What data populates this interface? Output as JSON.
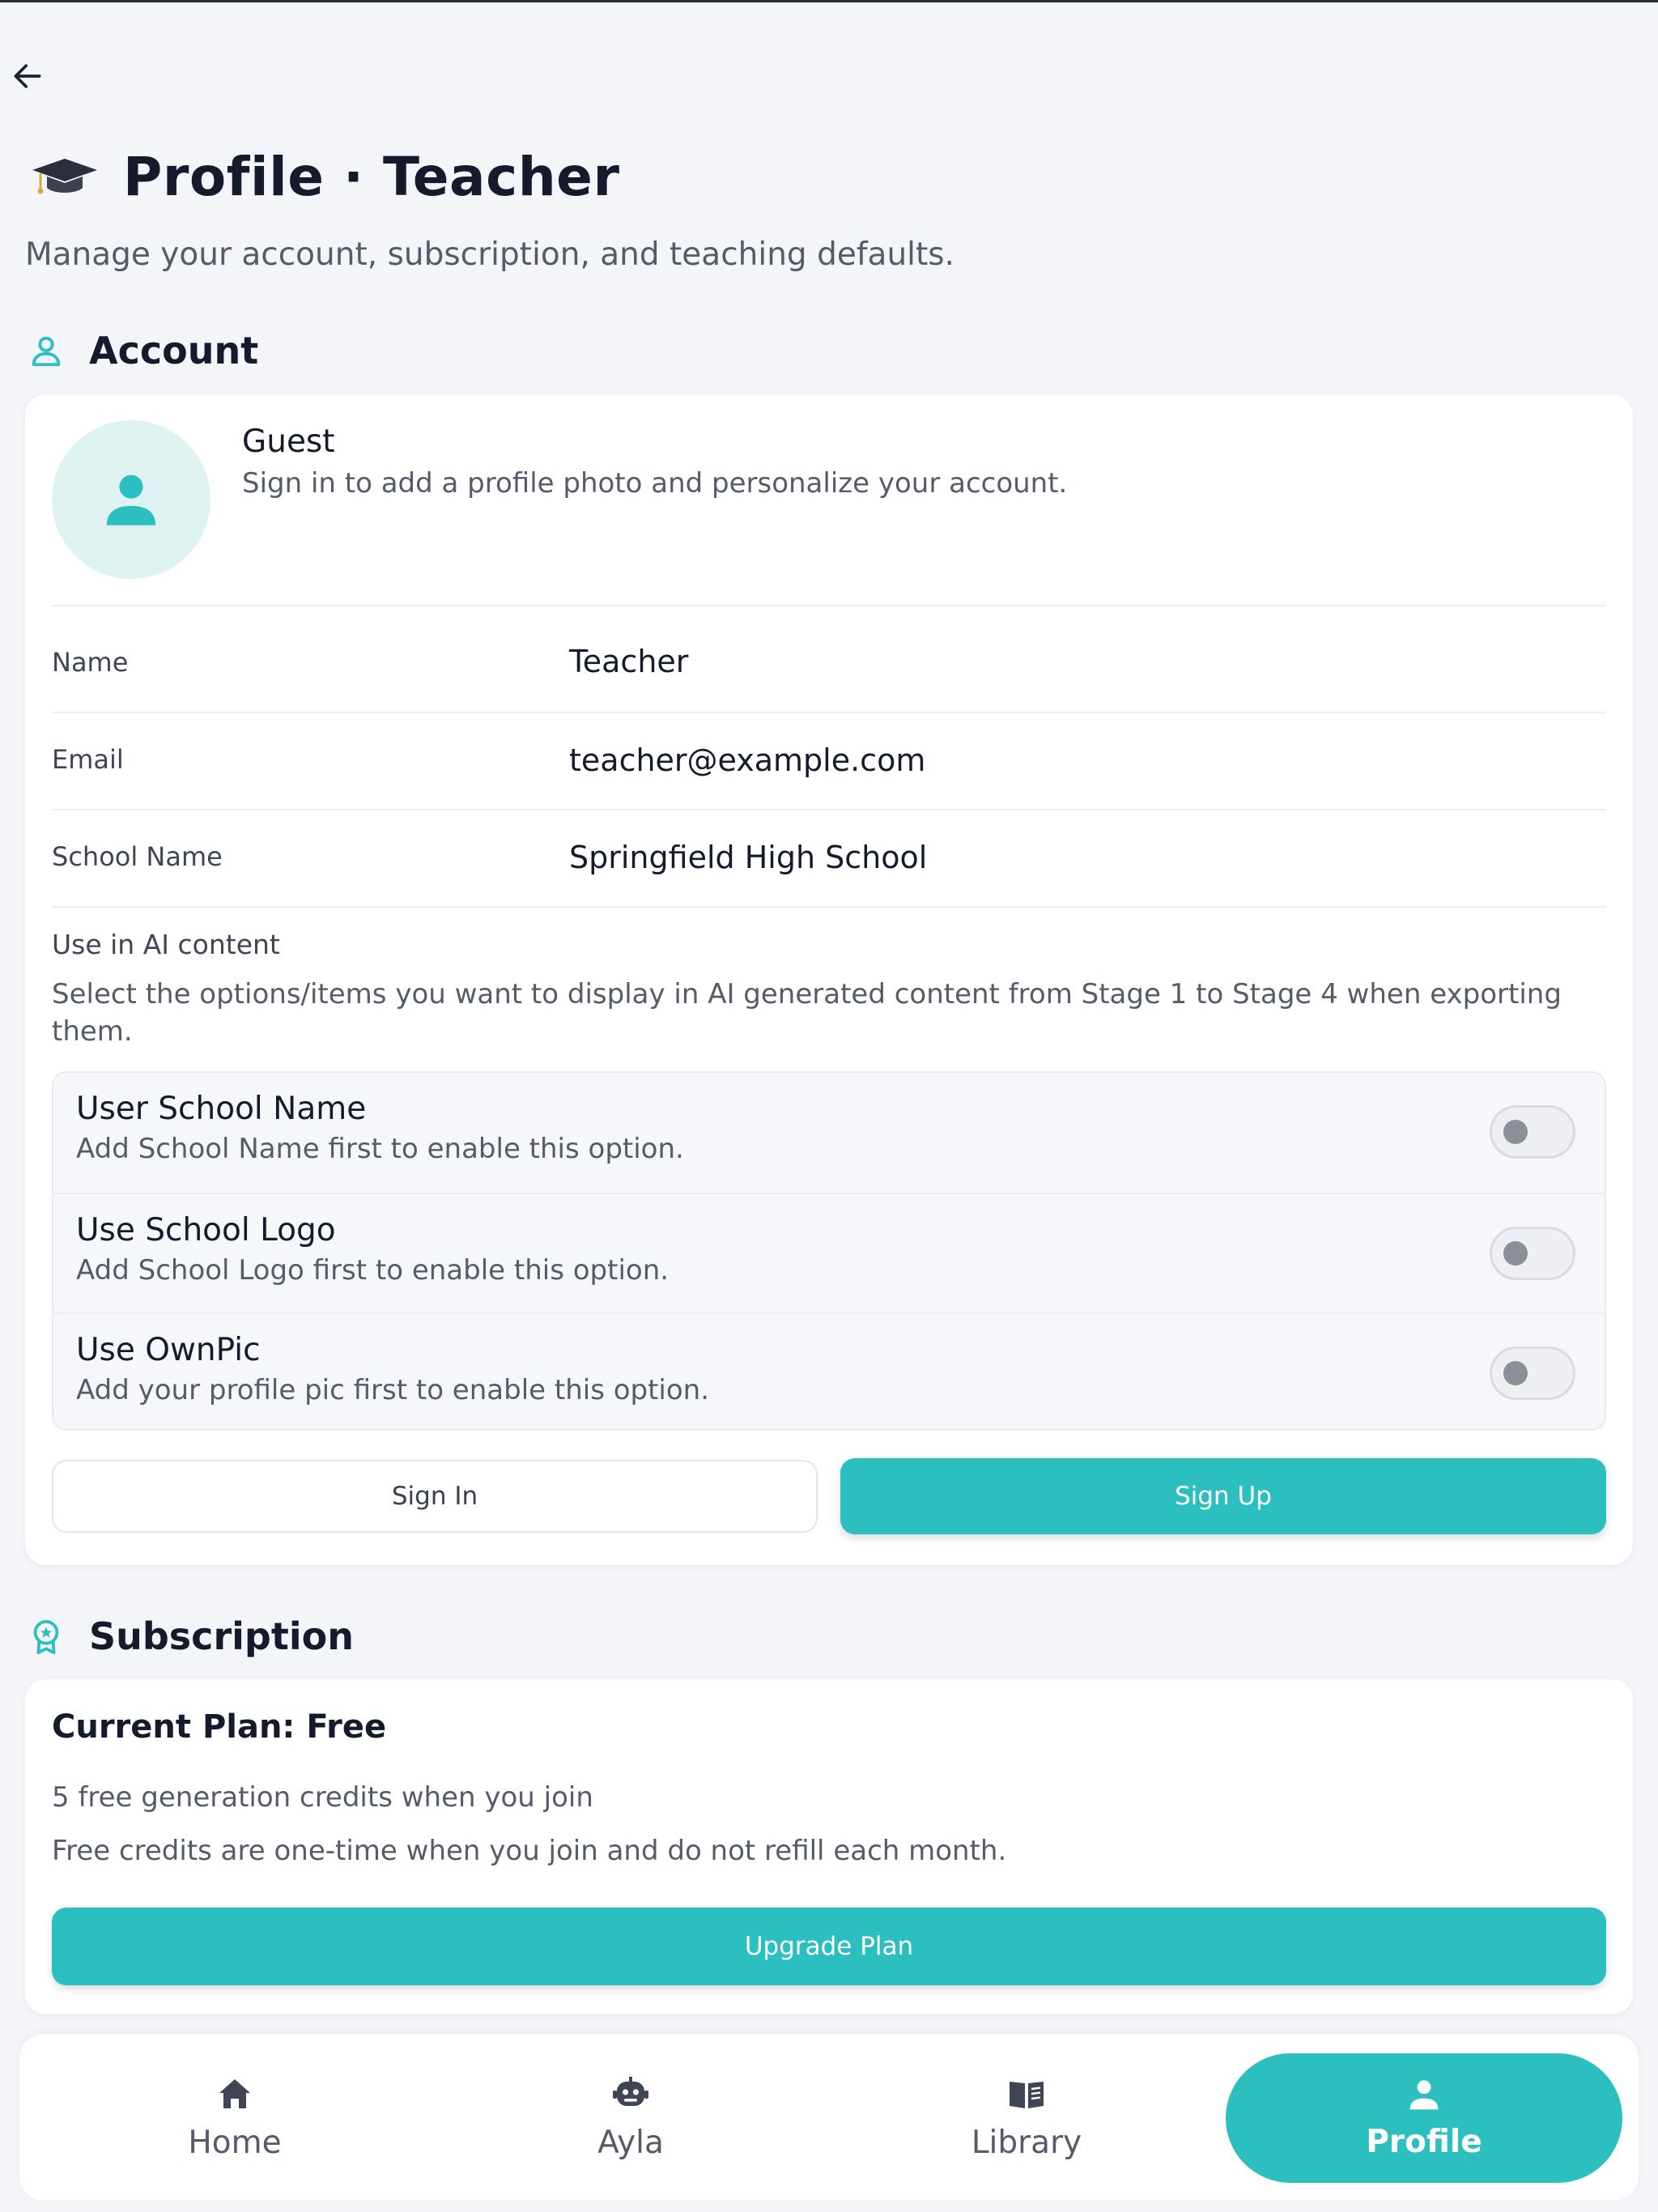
{
  "header": {
    "title": "Profile · Teacher",
    "subtitle": "Manage your account, subscription, and teaching defaults."
  },
  "account": {
    "section_title": "Account",
    "guest_name": "Guest",
    "guest_hint": "Sign in to add a profile photo and personalize your account.",
    "fields": [
      {
        "label": "Name",
        "value": "Teacher"
      },
      {
        "label": "Email",
        "value": "teacher@example.com"
      },
      {
        "label": "School Name",
        "value": "Springfield High School"
      }
    ],
    "ai_title": "Use in AI content",
    "ai_desc": "Select the options/items you want to display in AI generated content from Stage 1 to Stage 4 when exporting them.",
    "options": [
      {
        "title": "User School Name",
        "desc": "Add School Name first to enable this option.",
        "enabled": false
      },
      {
        "title": "Use School Logo",
        "desc": "Add School Logo first to enable this option.",
        "enabled": false
      },
      {
        "title": "Use OwnPic",
        "desc": "Add your profile pic first to enable this option.",
        "enabled": false
      }
    ],
    "sign_in_label": "Sign In",
    "sign_up_label": "Sign Up"
  },
  "subscription": {
    "section_title": "Subscription",
    "plan_title": "Current Plan: Free",
    "line1": "5 free generation credits when you join",
    "line2": "Free credits are one-time when you join and do not refill each month.",
    "upgrade_label": "Upgrade Plan"
  },
  "nav": {
    "items": [
      {
        "label": "Home",
        "icon": "home-icon"
      },
      {
        "label": "Ayla",
        "icon": "robot-icon"
      },
      {
        "label": "Library",
        "icon": "book-icon"
      },
      {
        "label": "Profile",
        "icon": "user-icon",
        "active": true
      }
    ]
  },
  "colors": {
    "accent": "#2bbfbf",
    "background": "#f4f5f9",
    "text_primary": "#151b2d",
    "text_secondary": "#555b68"
  }
}
